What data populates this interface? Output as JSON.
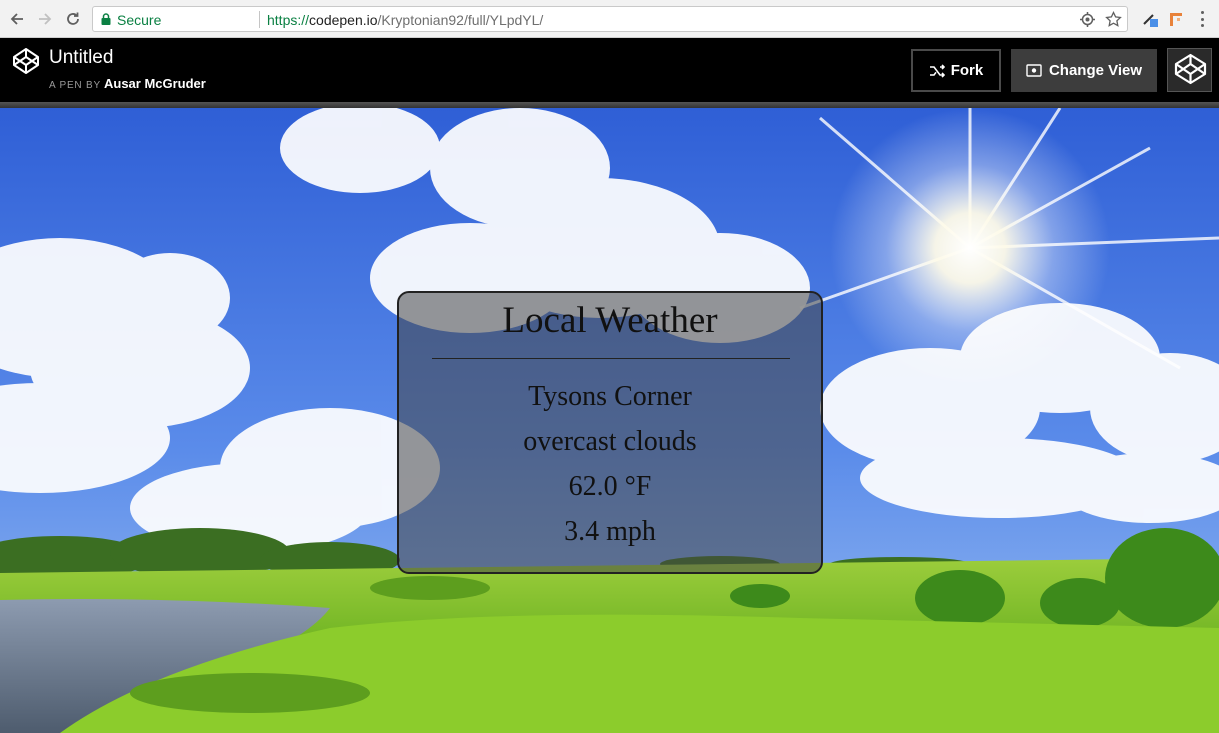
{
  "browser": {
    "secure_label": "Secure",
    "url_scheme": "https://",
    "url_host": "codepen.io",
    "url_path": "/Kryptonian92/full/YLpdYL/",
    "icons": [
      "back-icon",
      "forward-icon",
      "reload-icon",
      "lock-icon",
      "location-icon",
      "star-icon",
      "extension-icon",
      "menu-icon"
    ]
  },
  "header": {
    "title": "Untitled",
    "by_label": "A PEN BY",
    "author": "Ausar McGruder",
    "fork_label": "Fork",
    "change_view_label": "Change View"
  },
  "weather": {
    "title": "Local Weather",
    "location": "Tysons Corner",
    "conditions": "overcast clouds",
    "temperature": "62.0 °F",
    "wind": "3.4 mph"
  },
  "colors": {
    "secure_green": "#0b8043",
    "header_bg": "#000000",
    "change_view_bg": "#3d3d3d"
  }
}
